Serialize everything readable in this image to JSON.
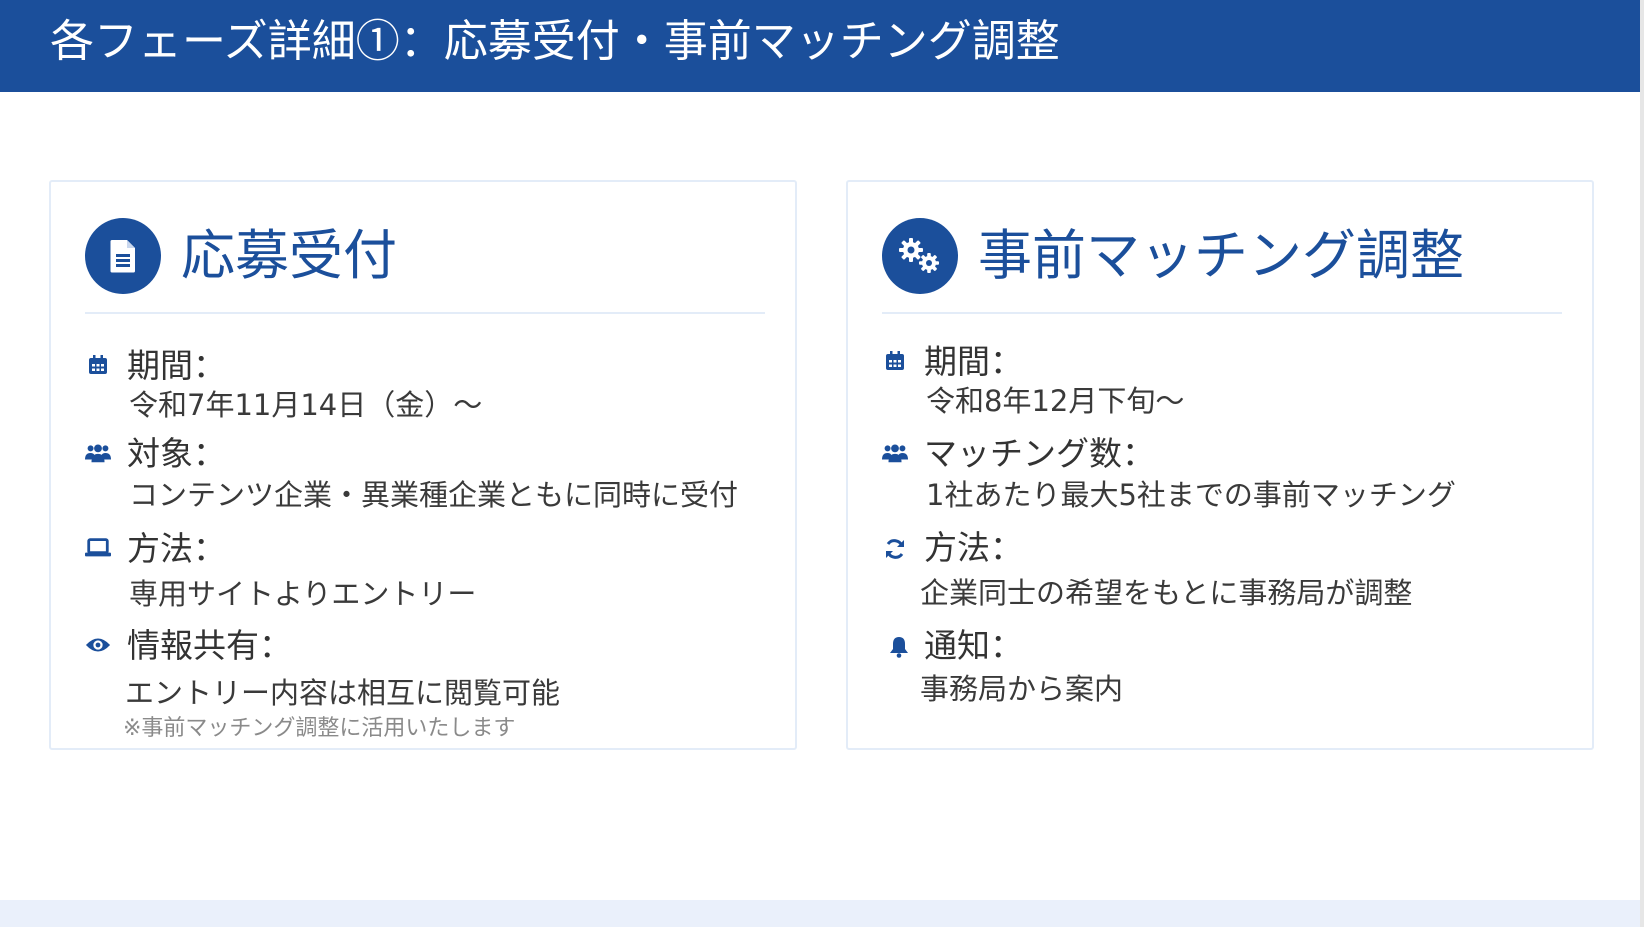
{
  "page": {
    "title": "各フェーズ詳細①：応募受付・事前マッチング調整"
  },
  "colors": {
    "primary": "#1b4f9b",
    "card_border": "#e3ecf8",
    "footer": "#eaf0fb"
  },
  "cards": [
    {
      "title": "応募受付",
      "icon": "document-icon",
      "sections": [
        {
          "icon": "calendar-icon",
          "label": "期間：",
          "value": "令和7年11月14日（金）〜"
        },
        {
          "icon": "users-icon",
          "label": "対象：",
          "value": "コンテンツ企業・異業種企業ともに同時に受付"
        },
        {
          "icon": "laptop-icon",
          "label": "方法：",
          "value": "専用サイトよりエントリー"
        },
        {
          "icon": "eye-icon",
          "label": "情報共有：",
          "value": "エントリー内容は相互に閲覧可能",
          "note": "※事前マッチング調整に活用いたします"
        }
      ]
    },
    {
      "title": "事前マッチング調整",
      "icon": "gears-icon",
      "sections": [
        {
          "icon": "calendar-icon",
          "label": "期間：",
          "value": "令和8年12月下旬〜"
        },
        {
          "icon": "users-icon",
          "label": "マッチング数：",
          "value": "1社あたり最大5社までの事前マッチング"
        },
        {
          "icon": "sync-icon",
          "label": "方法：",
          "value": "企業同士の希望をもとに事務局が調整"
        },
        {
          "icon": "bell-icon",
          "label": "通知：",
          "value": "事務局から案内"
        }
      ]
    }
  ]
}
